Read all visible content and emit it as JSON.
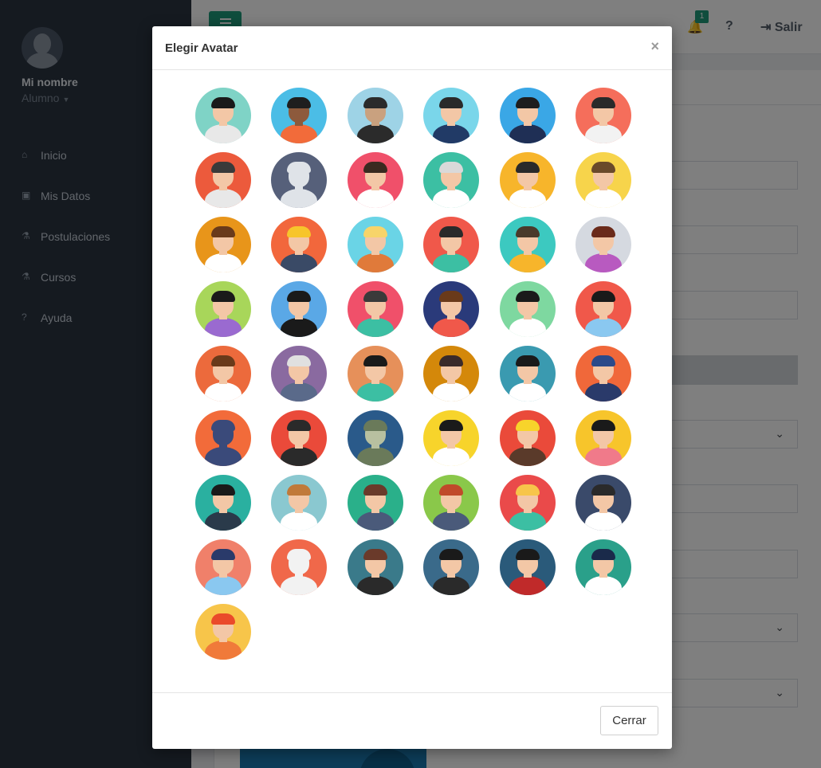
{
  "sidebar": {
    "user_name": "Mi nombre",
    "user_role": "Alumno",
    "items": [
      {
        "label": "Inicio",
        "icon": "home-icon"
      },
      {
        "label": "Mis Datos",
        "icon": "id-card-icon"
      },
      {
        "label": "Postulaciones",
        "icon": "flask-icon"
      },
      {
        "label": "Cursos",
        "icon": "flask-icon"
      },
      {
        "label": "Ayuda",
        "icon": "question-circle-icon"
      }
    ]
  },
  "topbar": {
    "notification_count": "1",
    "help_label": "?",
    "logout_label": "Salir"
  },
  "modal": {
    "title": "Elegir Avatar",
    "close_label": "×",
    "close_button_label": "Cerrar",
    "avatars": [
      {
        "name": "afro-sunglasses",
        "bg": "#7fd3c6",
        "skin": "#f3c7a6",
        "hair": "#1a1a1a",
        "shirt": "#e8e8e8"
      },
      {
        "name": "dark-skinned-man",
        "bg": "#4bbde6",
        "skin": "#8d5a3c",
        "hair": "#1e1e1e",
        "shirt": "#f26b3a"
      },
      {
        "name": "thief",
        "bg": "#9ed3e6",
        "skin": "#c9a17f",
        "hair": "#2b2b2b",
        "shirt": "#2b2b2b"
      },
      {
        "name": "businessman-blue",
        "bg": "#7ad6ea",
        "skin": "#f3c7a6",
        "hair": "#2a2a2a",
        "shirt": "#213a66"
      },
      {
        "name": "businessman-navy",
        "bg": "#3aa7e6",
        "skin": "#f3c7a6",
        "hair": "#1e1e1e",
        "shirt": "#1f2f55"
      },
      {
        "name": "businesswoman",
        "bg": "#f56e5b",
        "skin": "#f3c7a6",
        "hair": "#2a2a2a",
        "shirt": "#f2f2f2"
      },
      {
        "name": "headphones-woman",
        "bg": "#ec5a3c",
        "skin": "#f3c7a6",
        "hair": "#3a3a3a",
        "shirt": "#e8e8e8"
      },
      {
        "name": "silhouette",
        "bg": "#56607a",
        "skin": "#dfe3e8",
        "hair": "#dfe3e8",
        "shirt": "#dfe3e8"
      },
      {
        "name": "doctor-man",
        "bg": "#f0506a",
        "skin": "#f3c7a6",
        "hair": "#3a2a20",
        "shirt": "#ffffff"
      },
      {
        "name": "doctor-old",
        "bg": "#3cbfa3",
        "skin": "#f3c7a6",
        "hair": "#d9d9d9",
        "shirt": "#ffffff"
      },
      {
        "name": "doctor-yellow",
        "bg": "#f7b52b",
        "skin": "#f3c7a6",
        "hair": "#2a2a2a",
        "shirt": "#ffffff"
      },
      {
        "name": "doctor-woman",
        "bg": "#f7d44b",
        "skin": "#f3c7a6",
        "hair": "#6a4a2a",
        "shirt": "#ffffff"
      },
      {
        "name": "nurse-woman",
        "bg": "#e8951a",
        "skin": "#f3c7a6",
        "hair": "#6a3a1a",
        "shirt": "#ffffff"
      },
      {
        "name": "construction-man",
        "bg": "#f2673c",
        "skin": "#f3c7a6",
        "hair": "#f7c52b",
        "shirt": "#3a4a66"
      },
      {
        "name": "farmer",
        "bg": "#6ad4e6",
        "skin": "#f3c7a6",
        "hair": "#f7d46a",
        "shirt": "#e07a3a"
      },
      {
        "name": "medic-cross",
        "bg": "#f0584a",
        "skin": "#f3c7a6",
        "hair": "#2a2a2a",
        "shirt": "#3cbfa3"
      },
      {
        "name": "woman-teal",
        "bg": "#3cc9c0",
        "skin": "#f3c7a6",
        "hair": "#4a3a2a",
        "shirt": "#f7b52b"
      },
      {
        "name": "woman-long-hair",
        "bg": "#d5d9e0",
        "skin": "#f3c7a6",
        "hair": "#6a2a1a",
        "shirt": "#b85ac0"
      },
      {
        "name": "girl-braids",
        "bg": "#a8d65a",
        "skin": "#f3c7a6",
        "hair": "#1a1a1a",
        "shirt": "#9a6ad0"
      },
      {
        "name": "graduate-man",
        "bg": "#5aa8e6",
        "skin": "#f3c7a6",
        "hair": "#1a1a1a",
        "shirt": "#1a1a1a"
      },
      {
        "name": "graduates",
        "bg": "#f0506a",
        "skin": "#f3c7a6",
        "hair": "#3a3a3a",
        "shirt": "#3cbfa3"
      },
      {
        "name": "student-glasses",
        "bg": "#2a3a7a",
        "skin": "#f3c7a6",
        "hair": "#6a3a1a",
        "shirt": "#f0584a"
      },
      {
        "name": "man-red-tie",
        "bg": "#7ed8a0",
        "skin": "#f3c7a6",
        "hair": "#1a1a1a",
        "shirt": "#ffffff"
      },
      {
        "name": "man-beard-blue",
        "bg": "#f0584a",
        "skin": "#f3c7a6",
        "hair": "#1a1a1a",
        "shirt": "#8ac8f0"
      },
      {
        "name": "hipster-beard",
        "bg": "#ec6a3c",
        "skin": "#f3c7a6",
        "hair": "#6a3a1a",
        "shirt": "#ffffff"
      },
      {
        "name": "old-man-glasses",
        "bg": "#8a6aa0",
        "skin": "#f3c7a6",
        "hair": "#e0e0e0",
        "shirt": "#5a6a8a"
      },
      {
        "name": "woman-bob",
        "bg": "#e6905a",
        "skin": "#f3c7a6",
        "hair": "#1a1a1a",
        "shirt": "#3cbfa3"
      },
      {
        "name": "nurse-cap",
        "bg": "#d4880a",
        "skin": "#f3c7a6",
        "hair": "#3a2a2a",
        "shirt": "#ffffff"
      },
      {
        "name": "pilot",
        "bg": "#3a9ab0",
        "skin": "#f3c7a6",
        "hair": "#1a1a1a",
        "shirt": "#ffffff"
      },
      {
        "name": "police",
        "bg": "#f0683a",
        "skin": "#f3c7a6",
        "hair": "#2a4a8a",
        "shirt": "#2a3a6a"
      },
      {
        "name": "robot-bot",
        "bg": "#f26b3a",
        "skin": "#3a4a7a",
        "hair": "#3a4a7a",
        "shirt": "#3a4a7a"
      },
      {
        "name": "engineer-gears",
        "bg": "#ea4a3a",
        "skin": "#f3c7a6",
        "hair": "#2a2a2a",
        "shirt": "#2a2a2a"
      },
      {
        "name": "soldier",
        "bg": "#2a5a8a",
        "skin": "#b8c0a0",
        "hair": "#6a7a5a",
        "shirt": "#6a7a5a"
      },
      {
        "name": "schoolboy",
        "bg": "#f7d42b",
        "skin": "#f3c7a6",
        "hair": "#1a1a1a",
        "shirt": "#ffffff"
      },
      {
        "name": "taxi-driver",
        "bg": "#ea4a3a",
        "skin": "#f3c7a6",
        "hair": "#f7d42b",
        "shirt": "#5a3a2a"
      },
      {
        "name": "woman-bun",
        "bg": "#f7c52b",
        "skin": "#f3c7a6",
        "hair": "#1a1a1a",
        "shirt": "#f07a8a"
      },
      {
        "name": "woman-business-glasses",
        "bg": "#2ab0a0",
        "skin": "#f3c7a6",
        "hair": "#1a1a1a",
        "shirt": "#2a3a4a"
      },
      {
        "name": "call-center",
        "bg": "#8ac8d0",
        "skin": "#f3c7a6",
        "hair": "#c07a3a",
        "shirt": "#ffffff"
      },
      {
        "name": "man-green",
        "bg": "#2ab08a",
        "skin": "#f3c7a6",
        "hair": "#6a3a2a",
        "shirt": "#4a5a7a"
      },
      {
        "name": "farmer-overalls",
        "bg": "#8ac84a",
        "skin": "#f3c7a6",
        "hair": "#c04a2a",
        "shirt": "#4a5a7a"
      },
      {
        "name": "blonde-woman",
        "bg": "#ea4a4a",
        "skin": "#f3c7a6",
        "hair": "#f7c54a",
        "shirt": "#3cbfa3"
      },
      {
        "name": "man-suit-dark",
        "bg": "#3a4a6a",
        "skin": "#f3c7a6",
        "hair": "#2a2a2a",
        "shirt": "#ffffff"
      },
      {
        "name": "speaker",
        "bg": "#f0806a",
        "skin": "#f3c7a6",
        "hair": "#2a3a6a",
        "shirt": "#8ac8f0"
      },
      {
        "name": "group-silhouette",
        "bg": "#f0684a",
        "skin": "#f2f2f2",
        "hair": "#f2f2f2",
        "shirt": "#f2f2f2"
      },
      {
        "name": "woman-vest",
        "bg": "#3a7a8a",
        "skin": "#f3c7a6",
        "hair": "#6a3a2a",
        "shirt": "#2a2a2a"
      },
      {
        "name": "man-glasses-dark",
        "bg": "#3a6a8a",
        "skin": "#f3c7a6",
        "hair": "#1a1a1a",
        "shirt": "#2a2a2a"
      },
      {
        "name": "woman-red",
        "bg": "#2a5a7a",
        "skin": "#f3c7a6",
        "hair": "#1a1a1a",
        "shirt": "#c02a2a"
      },
      {
        "name": "woman-doctor-teal",
        "bg": "#2aa08a",
        "skin": "#f3c7a6",
        "hair": "#1a2a4a",
        "shirt": "#ffffff"
      },
      {
        "name": "worker-helmet",
        "bg": "#f7c54a",
        "skin": "#f3c7a6",
        "hair": "#ea4a2a",
        "shirt": "#f07a3a"
      }
    ]
  }
}
